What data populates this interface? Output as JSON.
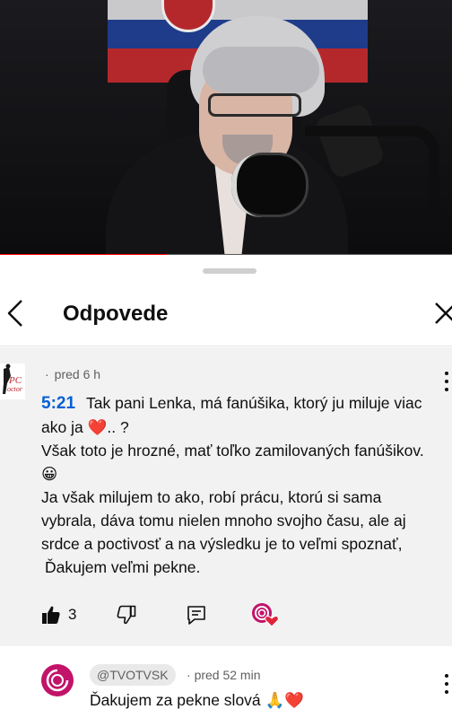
{
  "video": {
    "progress_fraction": 0.37
  },
  "sheet": {
    "title": "Odpovede"
  },
  "parent_comment": {
    "time_ago": "pred 6 h",
    "timestamp_link": "5:21",
    "line1": "Tak pani Lenka, má fanúšika, ktorý ju miluje viac ako ja",
    "line1_emoji": "❤️",
    "line1_tail": ".. ?",
    "line2": "Však toto je hrozné, mať toľko zamilovaných fanúšikov.",
    "line2_emoji": "😀",
    "line3": "Ja však milujem to ako, robí prácu, ktorú si sama vybrala, dáva tomu nielen mnoho svojho času, ale aj srdce a poctivosť a na výsledku je to veľmi spoznať,",
    "line4": "Ďakujem veľmi pekne.",
    "like_count": "3",
    "creator_heart": true
  },
  "reply": {
    "handle": "@TVOTVSK",
    "time_ago": "pred 52 min",
    "text": "Ďakujem za pekne slová",
    "emojis": "🙏❤️"
  },
  "colors": {
    "timestamp_link": "#065fd4",
    "progress": "#ff0000",
    "channel_avatar": "#c2136a",
    "heart": "#e0243c"
  }
}
